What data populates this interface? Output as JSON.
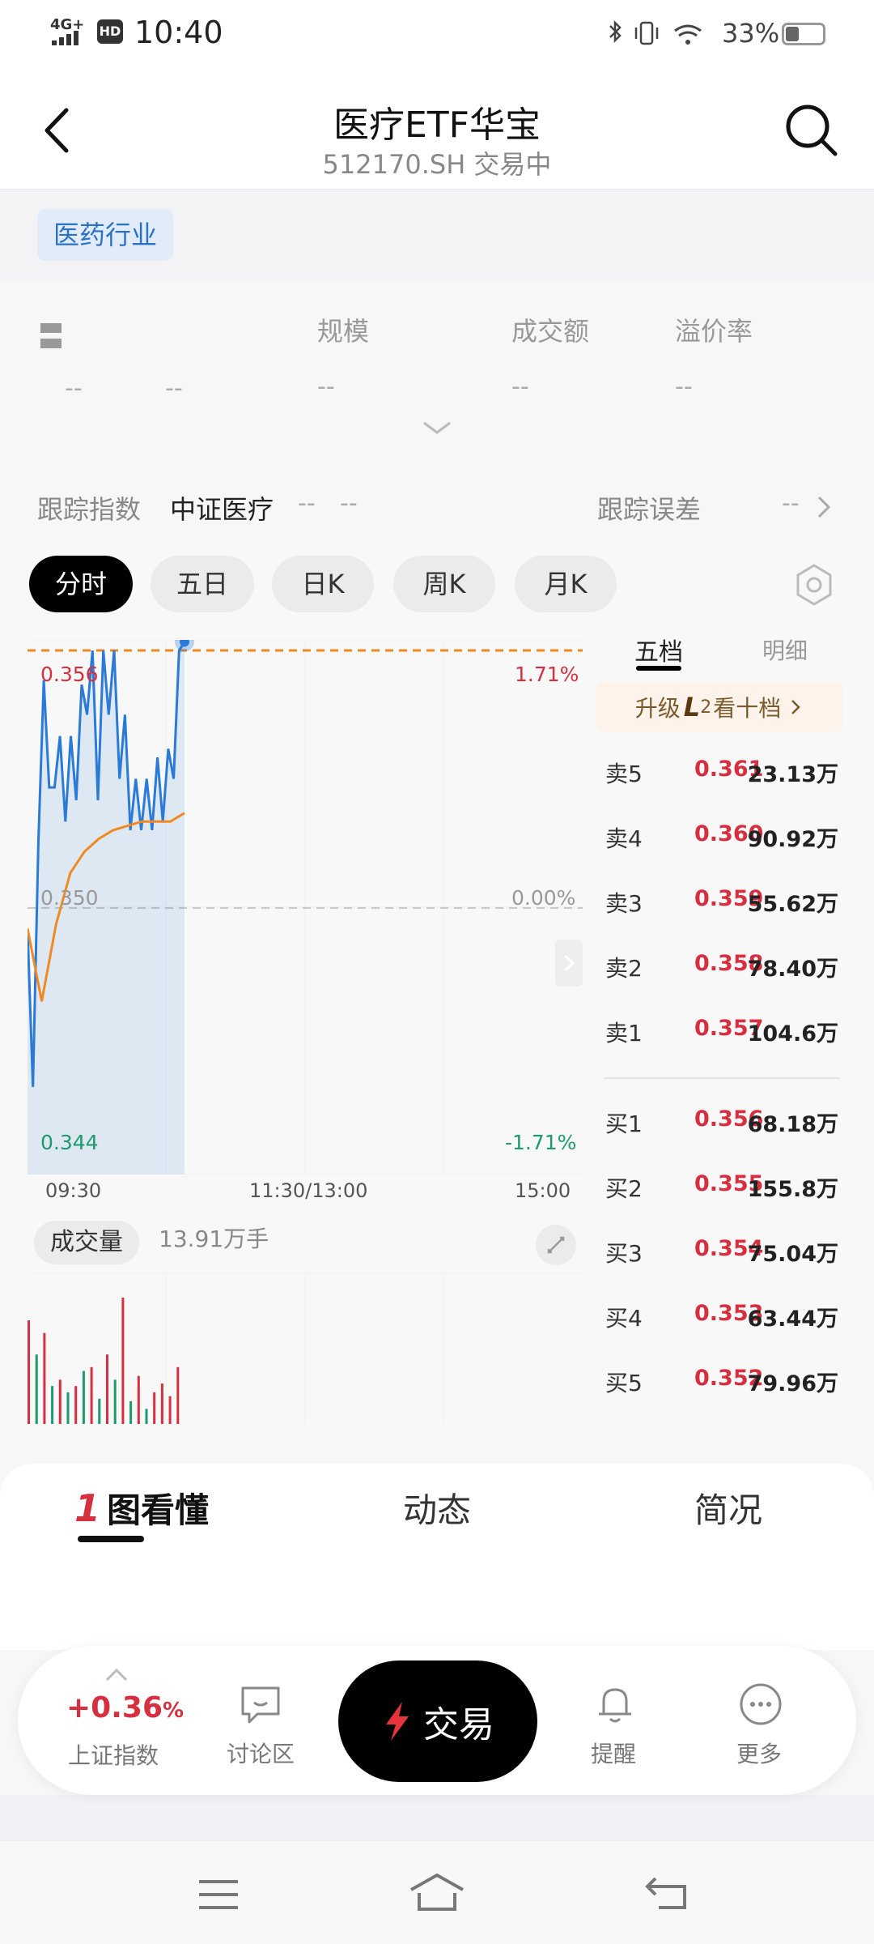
{
  "status_bar": {
    "network": "4G+",
    "hd": "HD",
    "time": "10:40",
    "battery": "33%"
  },
  "header": {
    "title": "医疗ETF华宝",
    "subtitle": "512170.SH 交易中"
  },
  "tag": "医药行业",
  "stats": {
    "price_placeholder": "--",
    "sub1": "--",
    "sub2": "--",
    "labels": [
      "规模",
      "成交额",
      "溢价率"
    ],
    "values": [
      "--",
      "--",
      "--"
    ],
    "tracking_label": "跟踪指数",
    "tracking_index": "中证医疗",
    "tracking_v1": "--",
    "tracking_v2": "--",
    "error_label": "跟踪误差",
    "error_value": "--"
  },
  "period_tabs": [
    "分时",
    "五日",
    "日K",
    "周K",
    "月K"
  ],
  "chart": {
    "price_high": "0.356",
    "price_mid": "0.350",
    "price_low": "0.344",
    "pct_high": "1.71%",
    "pct_mid": "0.00%",
    "pct_low": "-1.71%",
    "time_start": "09:30",
    "time_mid": "11:30/13:00",
    "time_end": "15:00",
    "volume_label": "成交量",
    "volume_value": "13.91万手"
  },
  "chart_data": {
    "type": "line",
    "x_range": [
      "09:30",
      "15:00"
    ],
    "ylim": [
      0.344,
      0.356
    ],
    "reference_price": 0.35,
    "series": [
      {
        "values": [
          0.3495,
          0.3458,
          0.3515,
          0.3553,
          0.3528,
          0.3528,
          0.354,
          0.352,
          0.354,
          0.3525,
          0.3552,
          0.3545,
          0.356,
          0.3525,
          0.356,
          0.3545,
          0.356,
          0.353,
          0.3545,
          0.3518,
          0.353,
          0.3518,
          0.353,
          0.3518,
          0.3535,
          0.352,
          0.3537,
          0.353,
          0.356,
          0.3562
        ]
      },
      {
        "values": [
          0.3495,
          0.3478,
          0.3496,
          0.3508,
          0.3513,
          0.3516,
          0.3518,
          0.3519,
          0.352,
          0.352,
          0.352,
          0.3522
        ]
      }
    ],
    "volume": {
      "red": [
        0.82,
        0.72,
        0.35,
        0.3,
        0.45,
        0.55,
        1.0,
        0.38,
        0.25,
        0.32,
        0.22,
        0.45
      ],
      "green": [
        0.55,
        0.3,
        0.25,
        0.42,
        0.2,
        0.35,
        0.18,
        0.12
      ]
    }
  },
  "order_book": {
    "tab_active": "五档",
    "tab_other": "明细",
    "upgrade_text": "升级",
    "upgrade_l2": "2",
    "upgrade_suffix": "看十档",
    "sells": [
      {
        "label": "卖5",
        "price": "0.361",
        "vol": "23.13万"
      },
      {
        "label": "卖4",
        "price": "0.360",
        "vol": "90.92万"
      },
      {
        "label": "卖3",
        "price": "0.359",
        "vol": "55.62万"
      },
      {
        "label": "卖2",
        "price": "0.358",
        "vol": "78.40万"
      },
      {
        "label": "卖1",
        "price": "0.357",
        "vol": "104.6万"
      }
    ],
    "buys": [
      {
        "label": "买1",
        "price": "0.356",
        "vol": "68.18万"
      },
      {
        "label": "买2",
        "price": "0.355",
        "vol": "155.8万"
      },
      {
        "label": "买3",
        "price": "0.354",
        "vol": "75.04万"
      },
      {
        "label": "买4",
        "price": "0.353",
        "vol": "63.44万"
      },
      {
        "label": "买5",
        "price": "0.352",
        "vol": "79.96万"
      }
    ]
  },
  "bottom_tabs": [
    "图看懂",
    "动态",
    "简况"
  ],
  "bottom_tab_icon_glyph": "1",
  "action_bar": {
    "index_change": "+0.36",
    "index_change_unit": "%",
    "index_name": "上证指数",
    "discussion": "讨论区",
    "trade": "交易",
    "alert": "提醒",
    "more": "更多"
  },
  "colors": {
    "red": "#d63040",
    "green": "#1e9a6e",
    "blue_line": "#2a7ad8",
    "orange_avg": "#f08a20",
    "tag_blue": "#2a72c8"
  }
}
